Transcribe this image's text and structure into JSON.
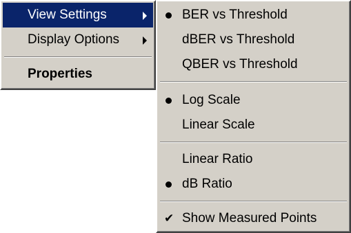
{
  "main_menu": {
    "items": [
      {
        "label": "View Settings",
        "selected": true,
        "submenu_arrow": "right-triangle-icon"
      },
      {
        "label": "Display Options",
        "submenu_arrow": "right-triangle-icon"
      },
      {
        "label": "Properties",
        "bold": true
      }
    ]
  },
  "view_settings_submenu": {
    "items": [
      {
        "label": "BER vs Threshold",
        "checked": true,
        "mark": "bullet-icon"
      },
      {
        "label": "dBER vs Threshold"
      },
      {
        "label": "QBER vs Threshold"
      },
      {
        "label": "Log Scale",
        "checked": true,
        "mark": "bullet-icon"
      },
      {
        "label": "Linear Scale"
      },
      {
        "label": "Linear Ratio"
      },
      {
        "label": "dB Ratio",
        "checked": true,
        "mark": "bullet-icon"
      },
      {
        "label": "Show Measured Points",
        "checked": true,
        "mark": "checkmark-icon",
        "glyph": "✔"
      }
    ]
  },
  "colors": {
    "menu_background": "#d4d0c8",
    "selection_background": "#0a246a",
    "selection_text": "#ffffff"
  }
}
